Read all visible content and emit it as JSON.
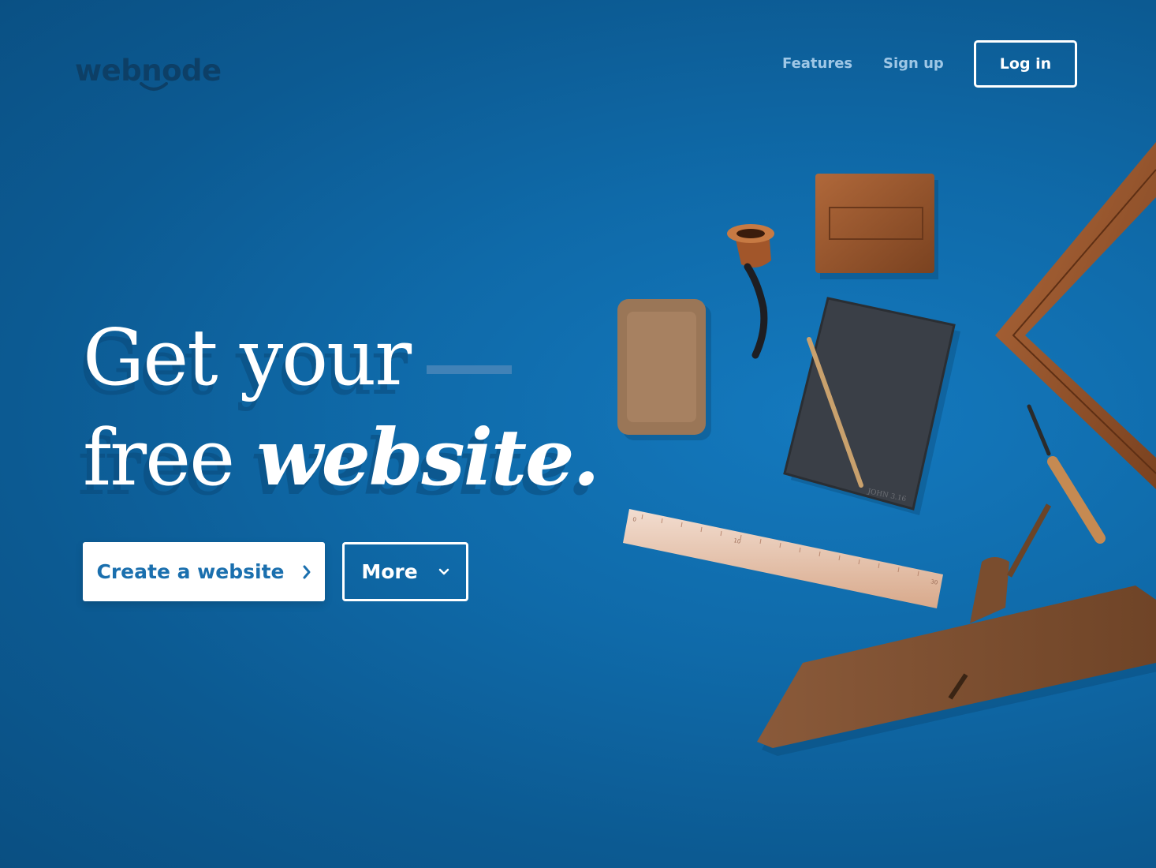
{
  "brand": {
    "name": "webnode"
  },
  "nav": {
    "features": "Features",
    "signup": "Sign up",
    "login": "Log in"
  },
  "hero": {
    "line1": "Get your",
    "line2_plain": "free",
    "line2_emphasis": "website."
  },
  "cta": {
    "create": "Create a website",
    "more": "More"
  },
  "ruler": {
    "label_start": "0",
    "label_mid": "10",
    "label_end": "30"
  },
  "book": {
    "spine_text": "JOHN 3.16"
  },
  "colors": {
    "background": "#0f6aa9",
    "accent": "#1a6fae",
    "logo": "#0d3f66"
  },
  "icons": [
    "chevron-right-icon",
    "chevron-down-icon"
  ]
}
